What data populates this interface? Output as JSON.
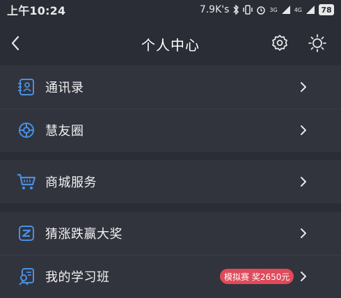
{
  "status_bar": {
    "time": "上午10:24",
    "net_speed": "7.9K's",
    "signal_1": "3G",
    "signal_2": "4G",
    "battery": "78"
  },
  "header": {
    "title": "个人中心",
    "back_icon": "chevron-left-icon",
    "settings_icon": "gear-icon",
    "theme_icon": "sun-icon"
  },
  "menu": {
    "contacts": {
      "label": "通讯录",
      "icon": "contacts-icon"
    },
    "friends_circle": {
      "label": "慧友圈",
      "icon": "friends-circle-icon"
    },
    "mall": {
      "label": "商城服务",
      "icon": "cart-icon"
    },
    "guess": {
      "label": "猜涨跌赢大奖",
      "icon": "guess-icon"
    },
    "study_class": {
      "label": "我的学习班",
      "icon": "study-icon",
      "badge": "模拟赛 奖2650元"
    }
  },
  "colors": {
    "background": "#2a2d35",
    "row_background": "#31343d",
    "accent_blue": "#4a90e2",
    "badge_red": "#e04a5a"
  }
}
